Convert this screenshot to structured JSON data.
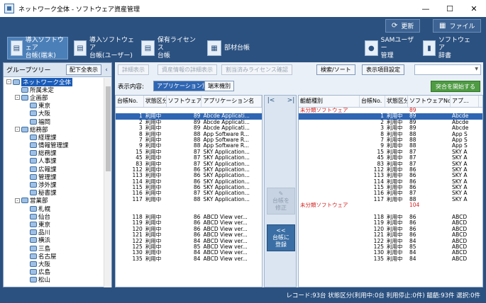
{
  "window": {
    "title": "ネットワーク全体 - ソフトウェア資産管理",
    "controls": [
      "—",
      "☐",
      "✕"
    ]
  },
  "toolbar1": {
    "refresh": "更新",
    "file": "ファイル"
  },
  "nav": [
    {
      "name": "nav-installed-device",
      "line1": "導入ソフトウェア",
      "line2": "台帳(端末)",
      "active": true
    },
    {
      "name": "nav-installed-user",
      "line1": "導入ソフトウェア",
      "line2": "台帳(ユーザー)",
      "active": false
    },
    {
      "name": "nav-license",
      "line1": "保有ライセンス",
      "line2": "台帳",
      "active": false
    },
    {
      "name": "nav-parts",
      "line1": "部材台帳",
      "line2": "",
      "active": false
    },
    {
      "name": "nav-sam-user",
      "line1": "SAMユーザー",
      "line2": "管理",
      "active": false
    },
    {
      "name": "nav-dictionary",
      "line1": "ソフトウェア",
      "line2": "辞書",
      "active": false
    }
  ],
  "left": {
    "title": "グループツリー",
    "expand_all": "配下全表示",
    "tree": [
      {
        "label": "ネットワーク全体",
        "level": 0,
        "toggle": "-",
        "selected": true
      },
      {
        "label": "所属未定",
        "level": 1,
        "toggle": "",
        "selected": false
      },
      {
        "label": "企画部",
        "level": 1,
        "toggle": "-",
        "selected": false
      },
      {
        "label": "東京",
        "level": 2,
        "toggle": "",
        "selected": false
      },
      {
        "label": "大阪",
        "level": 2,
        "toggle": "",
        "selected": false
      },
      {
        "label": "福岡",
        "level": 2,
        "toggle": "",
        "selected": false
      },
      {
        "label": "総務部",
        "level": 1,
        "toggle": "-",
        "selected": false
      },
      {
        "label": "経理課",
        "level": 2,
        "toggle": "",
        "selected": false
      },
      {
        "label": "情報管理課",
        "level": 2,
        "toggle": "",
        "selected": false
      },
      {
        "label": "総務課",
        "level": 2,
        "toggle": "",
        "selected": false
      },
      {
        "label": "人事課",
        "level": 2,
        "toggle": "",
        "selected": false
      },
      {
        "label": "広報課",
        "level": 2,
        "toggle": "",
        "selected": false
      },
      {
        "label": "管理課",
        "level": 2,
        "toggle": "",
        "selected": false
      },
      {
        "label": "渉外課",
        "level": 2,
        "toggle": "",
        "selected": false
      },
      {
        "label": "秘書課",
        "level": 2,
        "toggle": "",
        "selected": false
      },
      {
        "label": "営業部",
        "level": 1,
        "toggle": "-",
        "selected": false
      },
      {
        "label": "札幌",
        "level": 2,
        "toggle": "",
        "selected": false
      },
      {
        "label": "仙台",
        "level": 2,
        "toggle": "",
        "selected": false
      },
      {
        "label": "東京",
        "level": 2,
        "toggle": "",
        "selected": false
      },
      {
        "label": "品川",
        "level": 2,
        "toggle": "",
        "selected": false
      },
      {
        "label": "横浜",
        "level": 2,
        "toggle": "",
        "selected": false
      },
      {
        "label": "三島",
        "level": 2,
        "toggle": "",
        "selected": false
      },
      {
        "label": "名古屋",
        "level": 2,
        "toggle": "",
        "selected": false
      },
      {
        "label": "大阪",
        "level": 2,
        "toggle": "",
        "selected": false
      },
      {
        "label": "広島",
        "level": 2,
        "toggle": "",
        "selected": false
      },
      {
        "label": "松山",
        "level": 2,
        "toggle": "",
        "selected": false
      }
    ]
  },
  "actions": {
    "ledger_display": "詳細表示",
    "asset_detail": "資産情報の詳細表示",
    "assigned_license": "割当済みライセンス確認",
    "search_sort": "検索/ソート",
    "display_settings": "表示項目設定"
  },
  "show": {
    "label": "表示内容:",
    "by_app": "アプリケーション別",
    "by_device": "端末機別",
    "start": "突合を開始する"
  },
  "left_table": {
    "headers": [
      "台帳No.",
      "状態区分",
      "ソフトウェアNo.",
      "アプリケーション名"
    ],
    "rows": [
      {
        "no": "",
        "st": "",
        "sw": "",
        "nm": "",
        "sel": false
      },
      {
        "no": "1",
        "st": "利用中",
        "sw": "89",
        "nm": "Abcde Applicati...",
        "sel": true
      },
      {
        "no": "2",
        "st": "利用中",
        "sw": "89",
        "nm": "Abcde Applicati...",
        "sel": false
      },
      {
        "no": "3",
        "st": "利用中",
        "sw": "89",
        "nm": "Abcde Applicati...",
        "sel": false
      },
      {
        "no": "8",
        "st": "利用中",
        "sw": "88",
        "nm": "App Software R...",
        "sel": false
      },
      {
        "no": "7",
        "st": "利用中",
        "sw": "88",
        "nm": "App Software R...",
        "sel": false
      },
      {
        "no": "9",
        "st": "利用中",
        "sw": "88",
        "nm": "App Software R...",
        "sel": false
      },
      {
        "no": "15",
        "st": "利用中",
        "sw": "87",
        "nm": "SKY Application...",
        "sel": false
      },
      {
        "no": "45",
        "st": "利用中",
        "sw": "87",
        "nm": "SKY Application...",
        "sel": false
      },
      {
        "no": "83",
        "st": "利用中",
        "sw": "87",
        "nm": "SKY Application...",
        "sel": false
      },
      {
        "no": "112",
        "st": "利用中",
        "sw": "86",
        "nm": "SKY Application...",
        "sel": false
      },
      {
        "no": "113",
        "st": "利用中",
        "sw": "86",
        "nm": "SKY Application...",
        "sel": false
      },
      {
        "no": "114",
        "st": "利用中",
        "sw": "86",
        "nm": "SKY Application...",
        "sel": false
      },
      {
        "no": "115",
        "st": "利用中",
        "sw": "86",
        "nm": "SKY Application...",
        "sel": false
      },
      {
        "no": "116",
        "st": "利用中",
        "sw": "87",
        "nm": "SKY Application...",
        "sel": false
      },
      {
        "no": "117",
        "st": "利用中",
        "sw": "88",
        "nm": "SKY Application...",
        "sel": false
      },
      {
        "no": "",
        "st": "",
        "sw": "",
        "nm": "",
        "sel": false
      },
      {
        "no": "",
        "st": "",
        "sw": "",
        "nm": "",
        "sel": false
      },
      {
        "no": "118",
        "st": "利用中",
        "sw": "86",
        "nm": "ABCD View ver...",
        "sel": false
      },
      {
        "no": "119",
        "st": "利用中",
        "sw": "86",
        "nm": "ABCD View ver...",
        "sel": false
      },
      {
        "no": "120",
        "st": "利用中",
        "sw": "86",
        "nm": "ABCD View ver...",
        "sel": false
      },
      {
        "no": "121",
        "st": "利用中",
        "sw": "86",
        "nm": "ABCD View ver...",
        "sel": false
      },
      {
        "no": "122",
        "st": "利用中",
        "sw": "84",
        "nm": "ABCD View ver...",
        "sel": false
      },
      {
        "no": "125",
        "st": "利用中",
        "sw": "85",
        "nm": "ABCD View ver...",
        "sel": false
      },
      {
        "no": "130",
        "st": "利用中",
        "sw": "84",
        "nm": "ABCD View ver...",
        "sel": false
      },
      {
        "no": "135",
        "st": "利用中",
        "sw": "84",
        "nm": "ABCD View ver...",
        "sel": false
      }
    ]
  },
  "mid": {
    "first": "|<",
    "last": ">|",
    "edit_l1": "台帳を",
    "edit_l2": "修正",
    "reg_arrow": "<<",
    "reg_l1": "台帳に",
    "reg_l2": "登録"
  },
  "right_table": {
    "headers": [
      "齟齬種別",
      "台帳No.",
      "状態区分",
      "ソフトウェアNo.",
      "アプ..."
    ],
    "rows": [
      {
        "cat": "未分類ソフトウェア",
        "no": "",
        "st": "",
        "sw": "89",
        "nm": "",
        "red": true,
        "sel": false
      },
      {
        "cat": "",
        "no": "1",
        "st": "利用中",
        "sw": "89",
        "nm": "Abcde",
        "red": false,
        "sel": true
      },
      {
        "cat": "",
        "no": "2",
        "st": "利用中",
        "sw": "89",
        "nm": "Abcde",
        "red": false,
        "sel": false
      },
      {
        "cat": "",
        "no": "3",
        "st": "利用中",
        "sw": "89",
        "nm": "Abcde",
        "red": false,
        "sel": false
      },
      {
        "cat": "",
        "no": "8",
        "st": "利用中",
        "sw": "88",
        "nm": "App S",
        "red": false,
        "sel": false
      },
      {
        "cat": "",
        "no": "7",
        "st": "利用中",
        "sw": "88",
        "nm": "App S",
        "red": false,
        "sel": false
      },
      {
        "cat": "",
        "no": "9",
        "st": "利用中",
        "sw": "88",
        "nm": "App S",
        "red": false,
        "sel": false
      },
      {
        "cat": "",
        "no": "15",
        "st": "利用中",
        "sw": "87",
        "nm": "SKY A",
        "red": false,
        "sel": false
      },
      {
        "cat": "",
        "no": "45",
        "st": "利用中",
        "sw": "87",
        "nm": "SKY A",
        "red": false,
        "sel": false
      },
      {
        "cat": "",
        "no": "83",
        "st": "利用中",
        "sw": "87",
        "nm": "SKY A",
        "red": false,
        "sel": false
      },
      {
        "cat": "",
        "no": "112",
        "st": "利用中",
        "sw": "86",
        "nm": "SKY A",
        "red": false,
        "sel": false
      },
      {
        "cat": "",
        "no": "113",
        "st": "利用中",
        "sw": "86",
        "nm": "SKY A",
        "red": false,
        "sel": false
      },
      {
        "cat": "",
        "no": "114",
        "st": "利用中",
        "sw": "86",
        "nm": "SKY A",
        "red": false,
        "sel": false
      },
      {
        "cat": "",
        "no": "115",
        "st": "利用中",
        "sw": "86",
        "nm": "SKY A",
        "red": false,
        "sel": false
      },
      {
        "cat": "",
        "no": "116",
        "st": "利用中",
        "sw": "87",
        "nm": "SKY A",
        "red": false,
        "sel": false
      },
      {
        "cat": "",
        "no": "117",
        "st": "利用中",
        "sw": "88",
        "nm": "SKY A",
        "red": false,
        "sel": false
      },
      {
        "cat": "未分類ソフトウェア",
        "no": "",
        "st": "",
        "sw": "104",
        "nm": "",
        "red": true,
        "sel": false
      },
      {
        "cat": "",
        "no": "",
        "st": "",
        "sw": "",
        "nm": "",
        "red": false,
        "sel": false
      },
      {
        "cat": "",
        "no": "118",
        "st": "利用中",
        "sw": "86",
        "nm": "ABCD",
        "red": false,
        "sel": false
      },
      {
        "cat": "",
        "no": "119",
        "st": "利用中",
        "sw": "86",
        "nm": "ABCD",
        "red": false,
        "sel": false
      },
      {
        "cat": "",
        "no": "120",
        "st": "利用中",
        "sw": "86",
        "nm": "ABCD",
        "red": false,
        "sel": false
      },
      {
        "cat": "",
        "no": "121",
        "st": "利用中",
        "sw": "86",
        "nm": "ABCD",
        "red": false,
        "sel": false
      },
      {
        "cat": "",
        "no": "122",
        "st": "利用中",
        "sw": "84",
        "nm": "ABCD",
        "red": false,
        "sel": false
      },
      {
        "cat": "",
        "no": "125",
        "st": "利用中",
        "sw": "85",
        "nm": "ABCD",
        "red": false,
        "sel": false
      },
      {
        "cat": "",
        "no": "130",
        "st": "利用中",
        "sw": "84",
        "nm": "ABCD",
        "red": false,
        "sel": false
      },
      {
        "cat": "",
        "no": "135",
        "st": "利用中",
        "sw": "84",
        "nm": "ABCD",
        "red": false,
        "sel": false
      }
    ]
  },
  "status": "レコード:93台  状態区分(利用中:0台 利用停止:0件)  齟齬:93件  選択:0件"
}
